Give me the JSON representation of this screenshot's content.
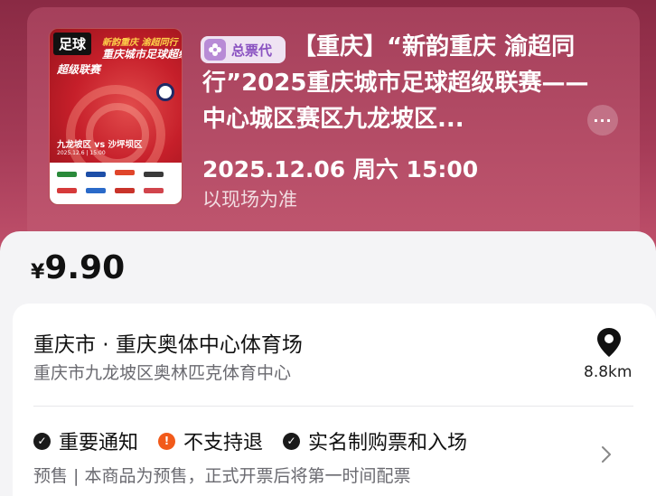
{
  "event": {
    "poster": {
      "badge": "足球",
      "line1": "新韵重庆 渝超同行",
      "line2": "重庆城市足球超级",
      "line3": "超级联赛",
      "teams": "九龙坡区 vs 沙坪坝区",
      "date": "2025.12.6 | 15:00"
    },
    "tag": "总票代",
    "title": "【重庆】“新韵重庆 渝超同行”2025重庆城市足球超级联赛——中心城区赛区九龙坡区...",
    "datetime": "2025.12.06 周六 15:00",
    "time_note": "以现场为准",
    "more": "···"
  },
  "price": {
    "currency": "¥",
    "amount": "9.90"
  },
  "venue": {
    "name": "重庆市 · 重庆奥体中心体育场",
    "address": "重庆市九龙坡区奥林匹克体育中心",
    "distance": "8.8km"
  },
  "notices": [
    {
      "icon": "check",
      "symbol": "✓",
      "label": "重要通知"
    },
    {
      "icon": "warn",
      "symbol": "!",
      "label": "不支持退"
    },
    {
      "icon": "check",
      "symbol": "✓",
      "label": "实名制购票和入场"
    }
  ],
  "presale_text": "预售 | 本商品为预售，正式开票后将第一时间配票",
  "colors": {
    "header_bg": "#a5405b",
    "tag_text": "#8a52c1",
    "warn": "#f25a1a"
  }
}
